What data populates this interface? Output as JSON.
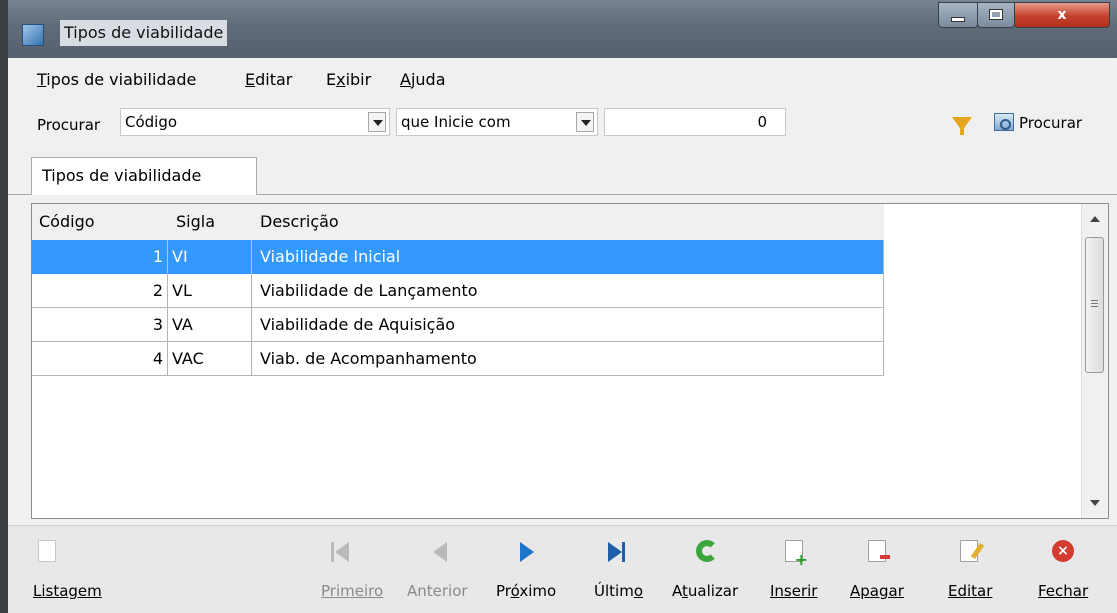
{
  "window": {
    "title": "Tipos de viabilidade",
    "close_glyph": "x"
  },
  "menu": [
    {
      "label": "Tipos de viabilidade",
      "accel": "T",
      "rest": "ipos de viabilidade"
    },
    {
      "label": "Editar",
      "accel": "E",
      "rest": "ditar"
    },
    {
      "label": "Exibir",
      "pre": "E",
      "accel": "x",
      "rest": "ibir"
    },
    {
      "label": "Ajuda",
      "accel": "A",
      "rest": "juda"
    }
  ],
  "search": {
    "label": "Procurar",
    "field": "Código",
    "condition": "que Inicie com",
    "value": "0",
    "button_label": "Procurar",
    "filter_icon": "funnel-icon"
  },
  "tab": {
    "label": "Tipos de viabilidade"
  },
  "table": {
    "columns": [
      "Código",
      "Sigla",
      "Descrição"
    ],
    "rows": [
      {
        "codigo": "1",
        "sigla": "VI",
        "descricao": "Viabilidade Inicial",
        "selected": true
      },
      {
        "codigo": "2",
        "sigla": "VL",
        "descricao": "Viabilidade de Lançamento"
      },
      {
        "codigo": "3",
        "sigla": "VA",
        "descricao": "Viabilidade de Aquisição"
      },
      {
        "codigo": "4",
        "sigla": "VAC",
        "descricao": "Viab. de Acompanhamento"
      }
    ]
  },
  "toolbar": {
    "listagem": "Listagem",
    "primeiro": "Primeiro",
    "anterior": "Anterior",
    "proximo_pre": "Pr",
    "proximo_u": "ó",
    "proximo_post": "ximo",
    "ultimo_pre": "Últim",
    "ultimo_u": "o",
    "atualizar_pre": "A",
    "atualizar_u": "t",
    "atualizar_post": "ualizar",
    "inserir": "Inserir",
    "apagar": "Apagar",
    "editar": "Editar",
    "fechar": "Fechar"
  },
  "colors": {
    "selection": "#3399ff",
    "titlebar": "#5f6b77",
    "close_button": "#c2412d"
  }
}
